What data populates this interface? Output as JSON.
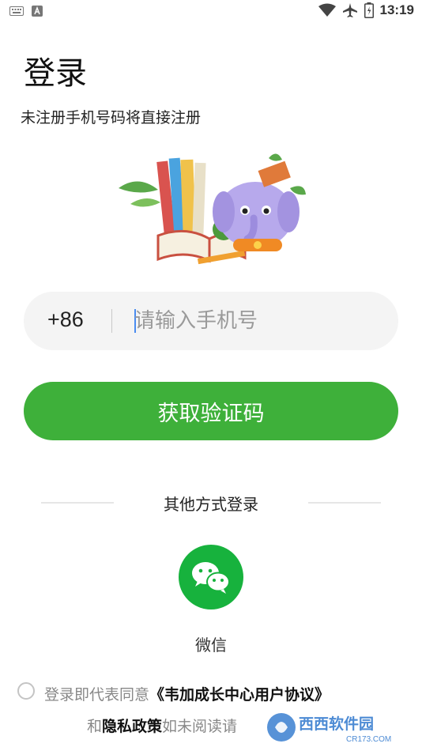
{
  "status_bar": {
    "time": "13:19",
    "left_icons": [
      "keyboard-icon",
      "a-notification-icon"
    ],
    "right_icons": [
      "wifi-icon",
      "airplane-icon",
      "battery-icon"
    ]
  },
  "page": {
    "title": "登录",
    "subtitle": "未注册手机号码将直接注册"
  },
  "phone": {
    "country_code": "+86",
    "placeholder": "请输入手机号",
    "value": ""
  },
  "actions": {
    "get_code_label": "获取验证码"
  },
  "other_login": {
    "label": "其他方式登录",
    "wechat_label": "微信"
  },
  "agreement": {
    "prefix": "登录即代表同意",
    "user_agreement": "《韦加成长中心用户协议》",
    "and": "和",
    "privacy": "隐私政策",
    "suffix": "如未阅读请"
  },
  "watermark": {
    "brand": "西西软件园",
    "domain": "CR173.COM"
  },
  "colors": {
    "primary_green": "#3eb03a",
    "wechat_green": "#17b23d",
    "input_bg": "#f4f4f4"
  }
}
